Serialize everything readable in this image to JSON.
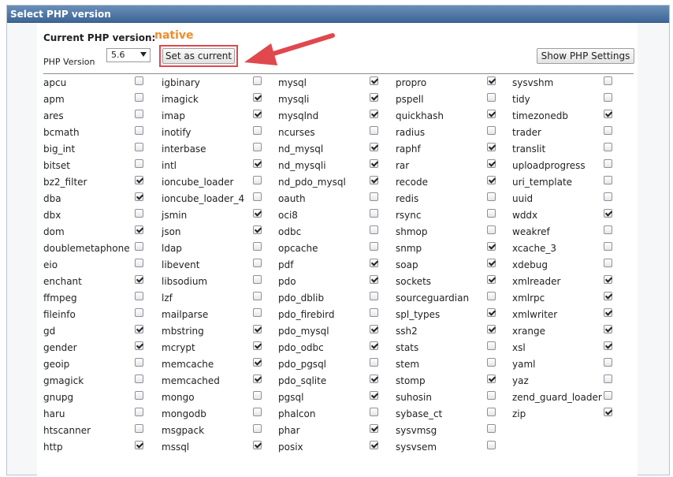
{
  "panel": {
    "title": "Select PHP version"
  },
  "current": {
    "label": "Current PHP version:",
    "value": "native",
    "value_color": "#f28b2c"
  },
  "version": {
    "label": "PHP Version",
    "selected": "5.6"
  },
  "buttons": {
    "set_current": "Set as current",
    "show_settings": "Show PHP Settings"
  },
  "columns": [
    [
      {
        "name": "apcu",
        "checked": false
      },
      {
        "name": "apm",
        "checked": false
      },
      {
        "name": "ares",
        "checked": false
      },
      {
        "name": "bcmath",
        "checked": false
      },
      {
        "name": "big_int",
        "checked": false
      },
      {
        "name": "bitset",
        "checked": false
      },
      {
        "name": "bz2_filter",
        "checked": true
      },
      {
        "name": "dba",
        "checked": true
      },
      {
        "name": "dbx",
        "checked": false
      },
      {
        "name": "dom",
        "checked": true
      },
      {
        "name": "doublemetaphone",
        "checked": false
      },
      {
        "name": "eio",
        "checked": false
      },
      {
        "name": "enchant",
        "checked": true
      },
      {
        "name": "ffmpeg",
        "checked": false
      },
      {
        "name": "fileinfo",
        "checked": false
      },
      {
        "name": "gd",
        "checked": true
      },
      {
        "name": "gender",
        "checked": true
      },
      {
        "name": "geoip",
        "checked": false
      },
      {
        "name": "gmagick",
        "checked": false
      },
      {
        "name": "gnupg",
        "checked": false
      },
      {
        "name": "haru",
        "checked": false
      },
      {
        "name": "htscanner",
        "checked": false
      },
      {
        "name": "http",
        "checked": true
      }
    ],
    [
      {
        "name": "igbinary",
        "checked": false
      },
      {
        "name": "imagick",
        "checked": true
      },
      {
        "name": "imap",
        "checked": true
      },
      {
        "name": "inotify",
        "checked": false
      },
      {
        "name": "interbase",
        "checked": false
      },
      {
        "name": "intl",
        "checked": true
      },
      {
        "name": "ioncube_loader",
        "checked": false
      },
      {
        "name": "ioncube_loader_4",
        "checked": false
      },
      {
        "name": "jsmin",
        "checked": true
      },
      {
        "name": "json",
        "checked": true
      },
      {
        "name": "ldap",
        "checked": false
      },
      {
        "name": "libevent",
        "checked": false
      },
      {
        "name": "libsodium",
        "checked": false
      },
      {
        "name": "lzf",
        "checked": false
      },
      {
        "name": "mailparse",
        "checked": false
      },
      {
        "name": "mbstring",
        "checked": true
      },
      {
        "name": "mcrypt",
        "checked": true
      },
      {
        "name": "memcache",
        "checked": true
      },
      {
        "name": "memcached",
        "checked": true
      },
      {
        "name": "mongo",
        "checked": false
      },
      {
        "name": "mongodb",
        "checked": false
      },
      {
        "name": "msgpack",
        "checked": false
      },
      {
        "name": "mssql",
        "checked": true
      }
    ],
    [
      {
        "name": "mysql",
        "checked": true
      },
      {
        "name": "mysqli",
        "checked": true
      },
      {
        "name": "mysqlnd",
        "checked": true
      },
      {
        "name": "ncurses",
        "checked": false
      },
      {
        "name": "nd_mysql",
        "checked": true
      },
      {
        "name": "nd_mysqli",
        "checked": true
      },
      {
        "name": "nd_pdo_mysql",
        "checked": true
      },
      {
        "name": "oauth",
        "checked": false
      },
      {
        "name": "oci8",
        "checked": false
      },
      {
        "name": "odbc",
        "checked": false
      },
      {
        "name": "opcache",
        "checked": false
      },
      {
        "name": "pdf",
        "checked": true
      },
      {
        "name": "pdo",
        "checked": true
      },
      {
        "name": "pdo_dblib",
        "checked": false
      },
      {
        "name": "pdo_firebird",
        "checked": false
      },
      {
        "name": "pdo_mysql",
        "checked": true
      },
      {
        "name": "pdo_odbc",
        "checked": true
      },
      {
        "name": "pdo_pgsql",
        "checked": false
      },
      {
        "name": "pdo_sqlite",
        "checked": true
      },
      {
        "name": "pgsql",
        "checked": true
      },
      {
        "name": "phalcon",
        "checked": false
      },
      {
        "name": "phar",
        "checked": true
      },
      {
        "name": "posix",
        "checked": true
      }
    ],
    [
      {
        "name": "propro",
        "checked": true
      },
      {
        "name": "pspell",
        "checked": false
      },
      {
        "name": "quickhash",
        "checked": true
      },
      {
        "name": "radius",
        "checked": false
      },
      {
        "name": "raphf",
        "checked": true
      },
      {
        "name": "rar",
        "checked": true
      },
      {
        "name": "recode",
        "checked": true
      },
      {
        "name": "redis",
        "checked": false
      },
      {
        "name": "rsync",
        "checked": false
      },
      {
        "name": "shmop",
        "checked": false
      },
      {
        "name": "snmp",
        "checked": true
      },
      {
        "name": "soap",
        "checked": true
      },
      {
        "name": "sockets",
        "checked": true
      },
      {
        "name": "sourceguardian",
        "checked": false
      },
      {
        "name": "spl_types",
        "checked": true
      },
      {
        "name": "ssh2",
        "checked": true
      },
      {
        "name": "stats",
        "checked": false
      },
      {
        "name": "stem",
        "checked": false
      },
      {
        "name": "stomp",
        "checked": true
      },
      {
        "name": "suhosin",
        "checked": false
      },
      {
        "name": "sybase_ct",
        "checked": false
      },
      {
        "name": "sysvmsg",
        "checked": false
      },
      {
        "name": "sysvsem",
        "checked": false
      }
    ],
    [
      {
        "name": "sysvshm",
        "checked": false
      },
      {
        "name": "tidy",
        "checked": false
      },
      {
        "name": "timezonedb",
        "checked": true
      },
      {
        "name": "trader",
        "checked": false
      },
      {
        "name": "translit",
        "checked": false
      },
      {
        "name": "uploadprogress",
        "checked": false
      },
      {
        "name": "uri_template",
        "checked": false
      },
      {
        "name": "uuid",
        "checked": false
      },
      {
        "name": "wddx",
        "checked": true
      },
      {
        "name": "weakref",
        "checked": false
      },
      {
        "name": "xcache_3",
        "checked": false
      },
      {
        "name": "xdebug",
        "checked": false
      },
      {
        "name": "xmlreader",
        "checked": true
      },
      {
        "name": "xmlrpc",
        "checked": true
      },
      {
        "name": "xmlwriter",
        "checked": true
      },
      {
        "name": "xrange",
        "checked": true
      },
      {
        "name": "xsl",
        "checked": true
      },
      {
        "name": "yaml",
        "checked": false
      },
      {
        "name": "yaz",
        "checked": false
      },
      {
        "name": "zend_guard_loader",
        "checked": false
      },
      {
        "name": "zip",
        "checked": true
      }
    ]
  ]
}
